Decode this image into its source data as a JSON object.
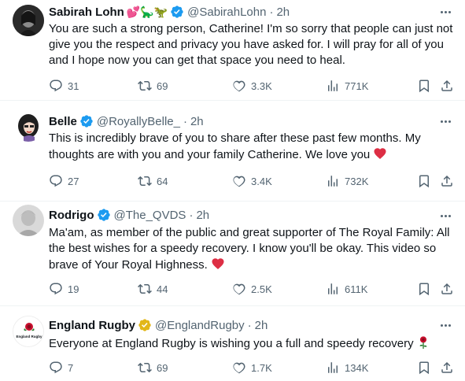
{
  "tweets": [
    {
      "name": "Sabirah Lohn",
      "emoji": "💕🦕🦖",
      "handle": "@SabirahLohn",
      "time": "2h",
      "text": "You are such a strong person, Catherine! I'm so sorry that people can just not give you the respect and privacy you have asked for. I will pray for all of you and I hope now you can get that space you need to heal.",
      "replies": "31",
      "reposts": "69",
      "likes": "3.3K",
      "views": "771K"
    },
    {
      "name": "Belle",
      "handle": "@RoyallyBelle_",
      "time": "2h",
      "text": "This is incredibly brave of you to share after these past few months. My thoughts are with you and your family Catherine. We love you",
      "replies": "27",
      "reposts": "64",
      "likes": "3.4K",
      "views": "732K"
    },
    {
      "name": "Rodrigo",
      "handle": "@The_QVDS",
      "time": "2h",
      "text": "Ma'am, as member of the public and great supporter of The Royal Family: All the best wishes for a speedy recovery. I know you'll be okay. This video so brave of Your Royal Highness.",
      "replies": "19",
      "reposts": "44",
      "likes": "2.5K",
      "views": "611K"
    },
    {
      "name": "England Rugby",
      "handle": "@EnglandRugby",
      "time": "2h",
      "text": "Everyone at England Rugby is wishing you a full and speedy recovery",
      "replies": "7",
      "reposts": "69",
      "likes": "1.7K",
      "views": "134K",
      "avatar_text": "England Rugby"
    }
  ],
  "colors": {
    "verified_blue": "#1d9bf0",
    "verified_gold": "#e2b719",
    "heart_red": "#f91880",
    "emoji_heart_red": "#dd2e44",
    "muted": "#536471"
  },
  "icons": [
    "reply-icon",
    "repost-icon",
    "like-icon",
    "views-icon",
    "bookmark-icon",
    "share-icon",
    "more-icon",
    "verified-badge-icon",
    "red-heart-icon",
    "rose-icon"
  ]
}
